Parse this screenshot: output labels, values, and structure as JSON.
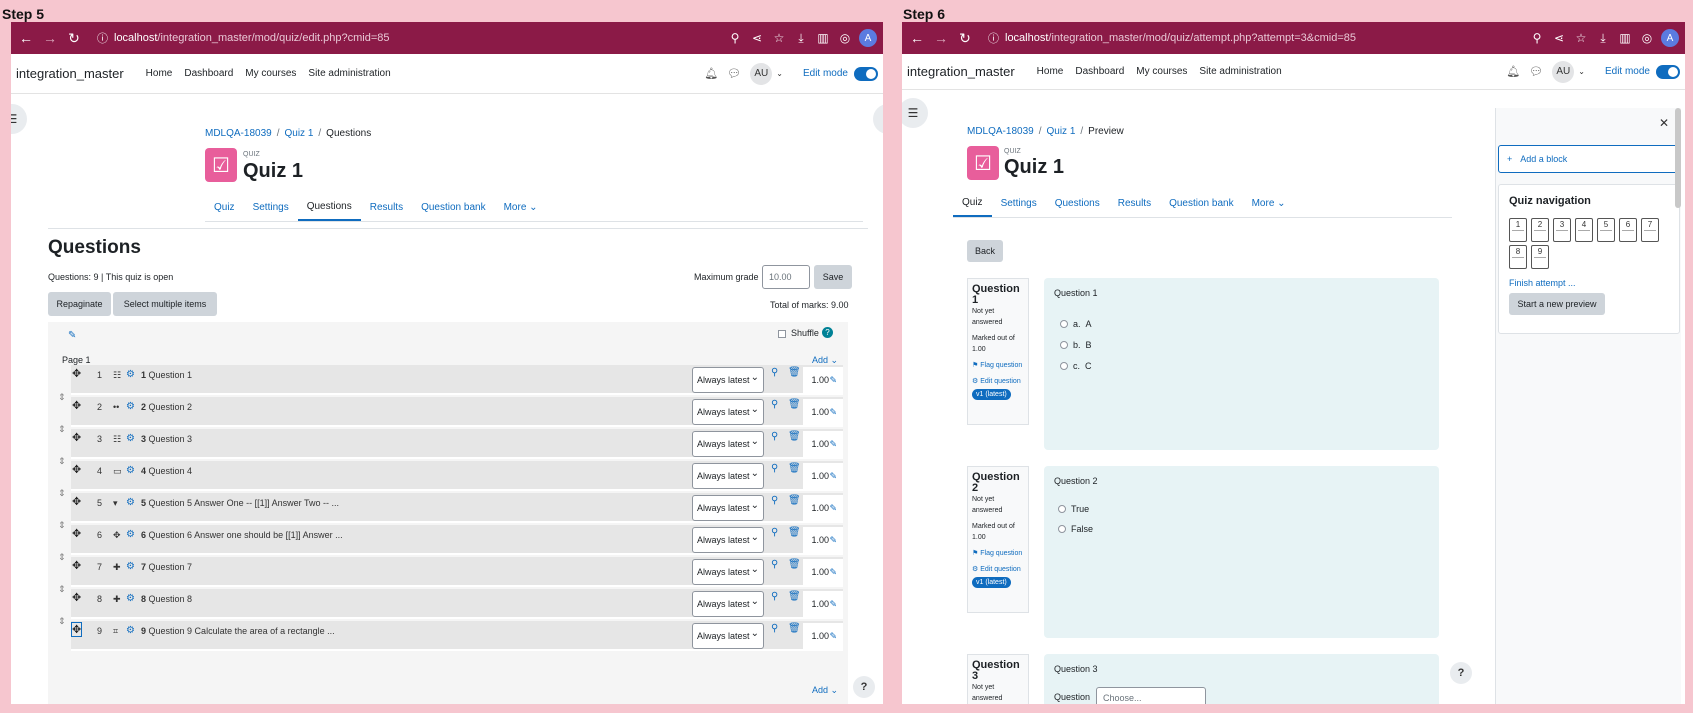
{
  "step5": {
    "label": "Step 5",
    "url_host": "localhost",
    "url_path": "/integration_master/mod/quiz/edit.php?cmid=85",
    "brand": "integration_master",
    "nav": [
      "Home",
      "Dashboard",
      "My courses",
      "Site administration"
    ],
    "user_initials": "AU",
    "edit_mode": "Edit mode",
    "breadcrumb": {
      "course": "MDLQA-18039",
      "quiz": "Quiz 1",
      "current": "Questions"
    },
    "quiz_small": "QUIZ",
    "quiz_title": "Quiz 1",
    "tabs": [
      "Quiz",
      "Settings",
      "Questions",
      "Results",
      "Question bank",
      "More"
    ],
    "heading": "Questions",
    "summary": "Questions: 9 | This quiz is open",
    "max_grade_label": "Maximum grade",
    "max_grade_value": "10.00",
    "save_label": "Save",
    "repaginate": "Repaginate",
    "select_multiple": "Select multiple items",
    "total_marks": "Total of marks: 9.00",
    "shuffle": "Shuffle",
    "page_label": "Page 1",
    "add_label": "Add",
    "version_option": "Always latest",
    "questions": [
      {
        "num": "1",
        "type_icon": "multichoice",
        "qnum": "1",
        "name": "Question 1",
        "mark": "1.00"
      },
      {
        "num": "2",
        "type_icon": "truefalse",
        "qnum": "2",
        "name": "Question 2",
        "mark": "1.00"
      },
      {
        "num": "3",
        "type_icon": "match",
        "qnum": "3",
        "name": "Question 3",
        "mark": "1.00"
      },
      {
        "num": "4",
        "type_icon": "shortanswer",
        "qnum": "4",
        "name": "Question 4",
        "mark": "1.00"
      },
      {
        "num": "5",
        "type_icon": "gapselect",
        "qnum": "5",
        "name": "Question 5 Answer One -- [[1]] Answer Two -- ...",
        "mark": "1.00"
      },
      {
        "num": "6",
        "type_icon": "ddwtos",
        "qnum": "6",
        "name": "Question 6 Answer one should be [[1]] Answer ...",
        "mark": "1.00"
      },
      {
        "num": "7",
        "type_icon": "ddimageortext",
        "qnum": "7",
        "name": "Question 7",
        "mark": "1.00"
      },
      {
        "num": "8",
        "type_icon": "ddmarker",
        "qnum": "8",
        "name": "Question 8",
        "mark": "1.00"
      },
      {
        "num": "9",
        "type_icon": "calculated",
        "qnum": "9",
        "name": "Question 9 Calculate the area of a rectangle ...",
        "mark": "1.00"
      }
    ]
  },
  "step6": {
    "label": "Step 6",
    "url_host": "localhost",
    "url_path": "/integration_master/mod/quiz/attempt.php?attempt=3&cmid=85",
    "brand": "integration_master",
    "nav": [
      "Home",
      "Dashboard",
      "My courses",
      "Site administration"
    ],
    "user_initials": "AU",
    "edit_mode": "Edit mode",
    "breadcrumb": {
      "course": "MDLQA-18039",
      "quiz": "Quiz 1",
      "current": "Preview"
    },
    "quiz_small": "QUIZ",
    "quiz_title": "Quiz 1",
    "tabs": [
      "Quiz",
      "Settings",
      "Questions",
      "Results",
      "Question bank",
      "More"
    ],
    "back": "Back",
    "questions": [
      {
        "label": "Question",
        "num": "1",
        "state": "Not yet answered",
        "marked": "Marked out of 1.00",
        "flag": "Flag question",
        "edit": "Edit question",
        "version": "v1 (latest)",
        "title": "Question 1",
        "options": [
          {
            "letter": "a.",
            "text": "A"
          },
          {
            "letter": "b.",
            "text": "B"
          },
          {
            "letter": "c.",
            "text": "C"
          }
        ]
      },
      {
        "label": "Question",
        "num": "2",
        "state": "Not yet answered",
        "marked": "Marked out of 1.00",
        "flag": "Flag question",
        "edit": "Edit question",
        "version": "v1 (latest)",
        "title": "Question 2",
        "options": [
          {
            "letter": "",
            "text": "True"
          },
          {
            "letter": "",
            "text": "False"
          }
        ]
      },
      {
        "label": "Question",
        "num": "3",
        "state": "Not yet answered",
        "title": "Question 3",
        "field_label": "Question",
        "choose": "Choose..."
      }
    ],
    "add_block": "Add a block",
    "nav_title": "Quiz navigation",
    "nav_numbers": [
      "1",
      "2",
      "3",
      "4",
      "5",
      "6",
      "7",
      "8",
      "9"
    ],
    "finish": "Finish attempt ...",
    "new_preview": "Start a new preview"
  },
  "colors": {
    "chrome": "#8b1a47",
    "accent": "#0f6cbf",
    "quiz_icon": "#e85e9b",
    "question_bg": "#e7f3f5"
  }
}
